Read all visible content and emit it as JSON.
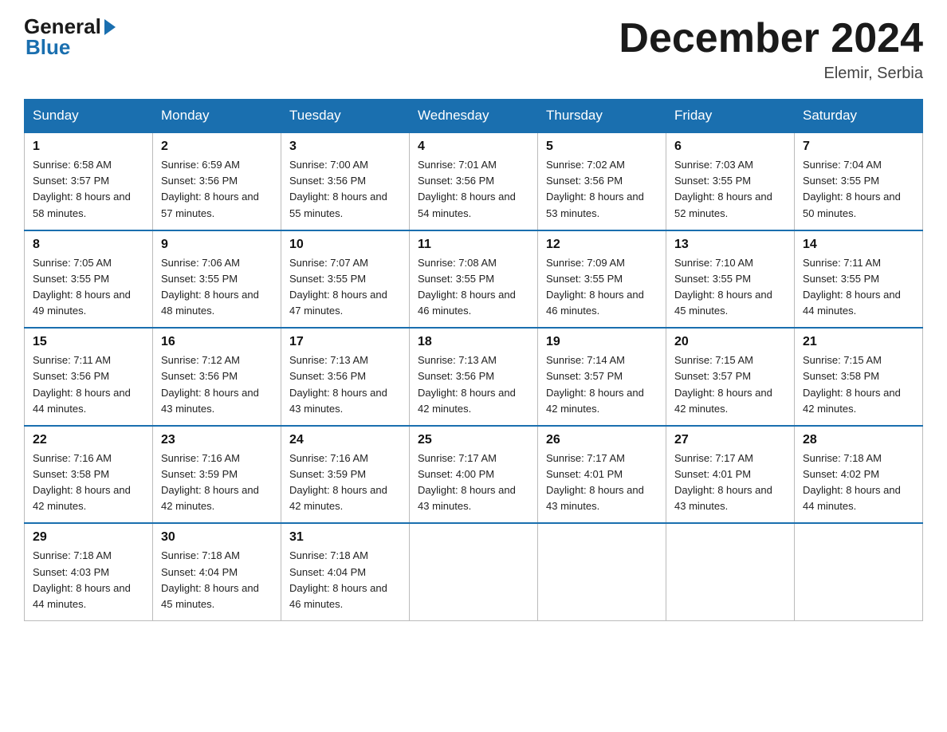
{
  "logo": {
    "general": "General",
    "blue": "Blue"
  },
  "title": "December 2024",
  "location": "Elemir, Serbia",
  "days_of_week": [
    "Sunday",
    "Monday",
    "Tuesday",
    "Wednesday",
    "Thursday",
    "Friday",
    "Saturday"
  ],
  "weeks": [
    [
      {
        "day": "1",
        "sunrise": "6:58 AM",
        "sunset": "3:57 PM",
        "daylight": "8 hours and 58 minutes."
      },
      {
        "day": "2",
        "sunrise": "6:59 AM",
        "sunset": "3:56 PM",
        "daylight": "8 hours and 57 minutes."
      },
      {
        "day": "3",
        "sunrise": "7:00 AM",
        "sunset": "3:56 PM",
        "daylight": "8 hours and 55 minutes."
      },
      {
        "day": "4",
        "sunrise": "7:01 AM",
        "sunset": "3:56 PM",
        "daylight": "8 hours and 54 minutes."
      },
      {
        "day": "5",
        "sunrise": "7:02 AM",
        "sunset": "3:56 PM",
        "daylight": "8 hours and 53 minutes."
      },
      {
        "day": "6",
        "sunrise": "7:03 AM",
        "sunset": "3:55 PM",
        "daylight": "8 hours and 52 minutes."
      },
      {
        "day": "7",
        "sunrise": "7:04 AM",
        "sunset": "3:55 PM",
        "daylight": "8 hours and 50 minutes."
      }
    ],
    [
      {
        "day": "8",
        "sunrise": "7:05 AM",
        "sunset": "3:55 PM",
        "daylight": "8 hours and 49 minutes."
      },
      {
        "day": "9",
        "sunrise": "7:06 AM",
        "sunset": "3:55 PM",
        "daylight": "8 hours and 48 minutes."
      },
      {
        "day": "10",
        "sunrise": "7:07 AM",
        "sunset": "3:55 PM",
        "daylight": "8 hours and 47 minutes."
      },
      {
        "day": "11",
        "sunrise": "7:08 AM",
        "sunset": "3:55 PM",
        "daylight": "8 hours and 46 minutes."
      },
      {
        "day": "12",
        "sunrise": "7:09 AM",
        "sunset": "3:55 PM",
        "daylight": "8 hours and 46 minutes."
      },
      {
        "day": "13",
        "sunrise": "7:10 AM",
        "sunset": "3:55 PM",
        "daylight": "8 hours and 45 minutes."
      },
      {
        "day": "14",
        "sunrise": "7:11 AM",
        "sunset": "3:55 PM",
        "daylight": "8 hours and 44 minutes."
      }
    ],
    [
      {
        "day": "15",
        "sunrise": "7:11 AM",
        "sunset": "3:56 PM",
        "daylight": "8 hours and 44 minutes."
      },
      {
        "day": "16",
        "sunrise": "7:12 AM",
        "sunset": "3:56 PM",
        "daylight": "8 hours and 43 minutes."
      },
      {
        "day": "17",
        "sunrise": "7:13 AM",
        "sunset": "3:56 PM",
        "daylight": "8 hours and 43 minutes."
      },
      {
        "day": "18",
        "sunrise": "7:13 AM",
        "sunset": "3:56 PM",
        "daylight": "8 hours and 42 minutes."
      },
      {
        "day": "19",
        "sunrise": "7:14 AM",
        "sunset": "3:57 PM",
        "daylight": "8 hours and 42 minutes."
      },
      {
        "day": "20",
        "sunrise": "7:15 AM",
        "sunset": "3:57 PM",
        "daylight": "8 hours and 42 minutes."
      },
      {
        "day": "21",
        "sunrise": "7:15 AM",
        "sunset": "3:58 PM",
        "daylight": "8 hours and 42 minutes."
      }
    ],
    [
      {
        "day": "22",
        "sunrise": "7:16 AM",
        "sunset": "3:58 PM",
        "daylight": "8 hours and 42 minutes."
      },
      {
        "day": "23",
        "sunrise": "7:16 AM",
        "sunset": "3:59 PM",
        "daylight": "8 hours and 42 minutes."
      },
      {
        "day": "24",
        "sunrise": "7:16 AM",
        "sunset": "3:59 PM",
        "daylight": "8 hours and 42 minutes."
      },
      {
        "day": "25",
        "sunrise": "7:17 AM",
        "sunset": "4:00 PM",
        "daylight": "8 hours and 43 minutes."
      },
      {
        "day": "26",
        "sunrise": "7:17 AM",
        "sunset": "4:01 PM",
        "daylight": "8 hours and 43 minutes."
      },
      {
        "day": "27",
        "sunrise": "7:17 AM",
        "sunset": "4:01 PM",
        "daylight": "8 hours and 43 minutes."
      },
      {
        "day": "28",
        "sunrise": "7:18 AM",
        "sunset": "4:02 PM",
        "daylight": "8 hours and 44 minutes."
      }
    ],
    [
      {
        "day": "29",
        "sunrise": "7:18 AM",
        "sunset": "4:03 PM",
        "daylight": "8 hours and 44 minutes."
      },
      {
        "day": "30",
        "sunrise": "7:18 AM",
        "sunset": "4:04 PM",
        "daylight": "8 hours and 45 minutes."
      },
      {
        "day": "31",
        "sunrise": "7:18 AM",
        "sunset": "4:04 PM",
        "daylight": "8 hours and 46 minutes."
      },
      null,
      null,
      null,
      null
    ]
  ]
}
